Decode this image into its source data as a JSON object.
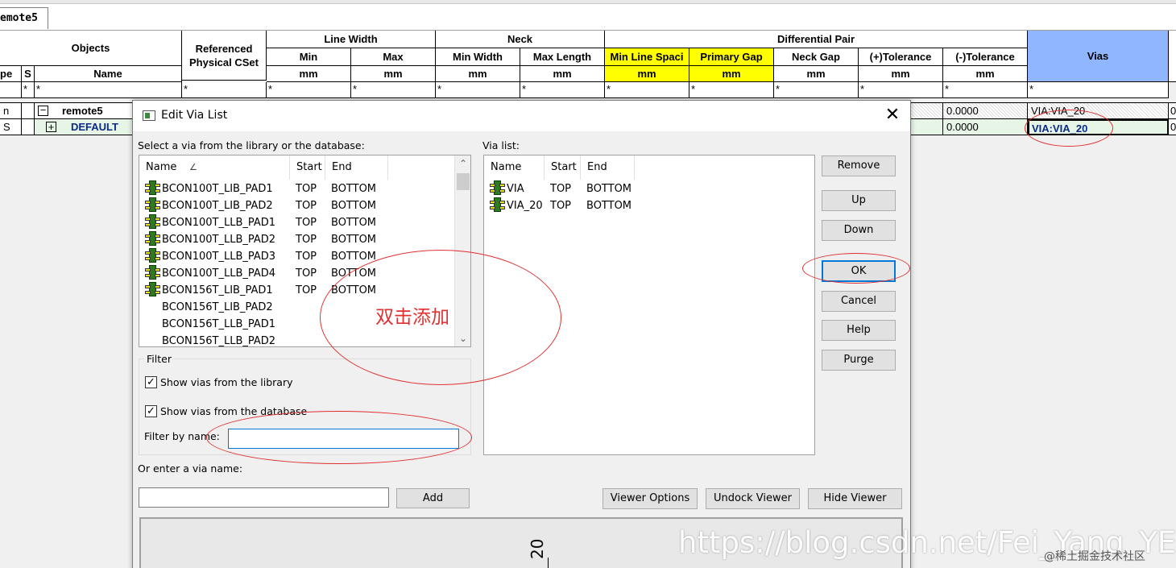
{
  "tab": {
    "label": "emote5"
  },
  "sheet": {
    "headers": {
      "objects": "Objects",
      "referenced": "Referenced\nPhysical CSet",
      "line_width": "Line Width",
      "neck": "Neck",
      "diff_pair": "Differential Pair",
      "vias": "Vias",
      "type_abbrev": "pe",
      "s": "S",
      "name": "Name",
      "min": "Min",
      "max": "Max",
      "min_width": "Min Width",
      "max_length": "Max Length",
      "min_line_spacing": "Min Line Spaci",
      "primary_gap": "Primary Gap",
      "neck_gap": "Neck Gap",
      "plus_tol": "(+)Tolerance",
      "minus_tol": "(-)Tolerance",
      "unit": "mm"
    },
    "filter_char": "*",
    "rows": [
      {
        "type": "n",
        "name": "remote5",
        "expander": "−",
        "minus_tol": "0.0000",
        "vias": "VIA:VIA_20",
        "last": "0"
      },
      {
        "type": "S",
        "name": "DEFAULT",
        "expander": "+",
        "minus_tol": "0.0000",
        "vias": "VIA:VIA_20",
        "last": "0"
      }
    ]
  },
  "dialog": {
    "title": "Edit Via List",
    "close_glyph": "✕",
    "select_label": "Select a via from the library or the database:",
    "lib_headers": {
      "name": "Name",
      "sort": "∠",
      "start": "Start",
      "end": "End"
    },
    "lib_rows": [
      {
        "name": "BCON100T_LIB_PAD1",
        "start": "TOP",
        "end": "BOTTOM",
        "icon": true
      },
      {
        "name": "BCON100T_LIB_PAD2",
        "start": "TOP",
        "end": "BOTTOM",
        "icon": true
      },
      {
        "name": "BCON100T_LLB_PAD1",
        "start": "TOP",
        "end": "BOTTOM",
        "icon": true
      },
      {
        "name": "BCON100T_LLB_PAD2",
        "start": "TOP",
        "end": "BOTTOM",
        "icon": true
      },
      {
        "name": "BCON100T_LLB_PAD3",
        "start": "TOP",
        "end": "BOTTOM",
        "icon": true
      },
      {
        "name": "BCON100T_LLB_PAD4",
        "start": "TOP",
        "end": "BOTTOM",
        "icon": true
      },
      {
        "name": "BCON156T_LIB_PAD1",
        "start": "TOP",
        "end": "BOTTOM",
        "icon": true
      },
      {
        "name": "BCON156T_LIB_PAD2",
        "start": "",
        "end": "",
        "icon": false
      },
      {
        "name": "BCON156T_LLB_PAD1",
        "start": "",
        "end": "",
        "icon": false
      },
      {
        "name": "BCON156T_LLB_PAD2",
        "start": "",
        "end": "",
        "icon": false
      }
    ],
    "filter_group": "Filter",
    "show_library": "Show vias from the library",
    "show_database": "Show vias from the database",
    "check_glyph": "✓",
    "filter_by_name": "Filter by name:",
    "filter_value": "",
    "or_enter": "Or enter a via name:",
    "via_name_value": "",
    "add": "Add",
    "via_list_label": "Via list:",
    "via_headers": {
      "name": "Name",
      "start": "Start",
      "end": "End"
    },
    "via_rows": [
      {
        "name": "VIA",
        "start": "TOP",
        "end": "BOTTOM"
      },
      {
        "name": "VIA_20",
        "start": "TOP",
        "end": "BOTTOM"
      }
    ],
    "buttons": {
      "remove": "Remove",
      "up": "Up",
      "down": "Down",
      "ok": "OK",
      "cancel": "Cancel",
      "help": "Help",
      "purge": "Purge"
    },
    "viewer_options": "Viewer Options",
    "undock_viewer": "Undock Viewer",
    "hide_viewer": "Hide Viewer",
    "viewer_text": "20",
    "scroll_up": "⌃",
    "scroll_down": "⌄"
  },
  "annotation": {
    "text": "双击添加",
    "color": "#e03030"
  },
  "watermark": {
    "url": "https://blog.csdn.net/Fei_Yang_YE",
    "site": "@稀土掘金技术社区"
  }
}
